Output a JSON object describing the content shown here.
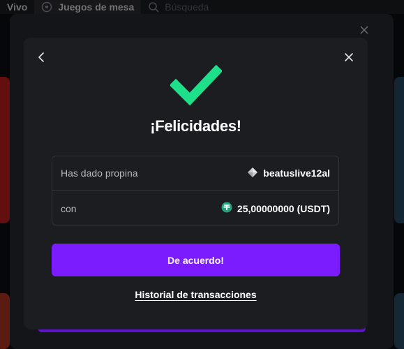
{
  "background": {
    "tabs": [
      {
        "label": "Vivo"
      },
      {
        "label": "Juegos de mesa"
      },
      {
        "label": "Búsqueda"
      }
    ]
  },
  "modal": {
    "title": "¡Felicidades!",
    "tip_row": {
      "label": "Has dado propina",
      "value": "beatuslive12al"
    },
    "amount_row": {
      "label": "con",
      "value": "25,00000000 (USDT)"
    },
    "confirm_button": "De acuerdo!",
    "history_link": "Historial de transacciones"
  },
  "colors": {
    "accent_purple": "#7b1cff",
    "success_green": "#1fe08a",
    "tether_green": "#26a17b"
  },
  "icons": {
    "back": "chevron-left-icon",
    "close": "close-icon",
    "success": "checkmark-icon",
    "user": "diamond-icon",
    "currency": "tether-icon"
  }
}
